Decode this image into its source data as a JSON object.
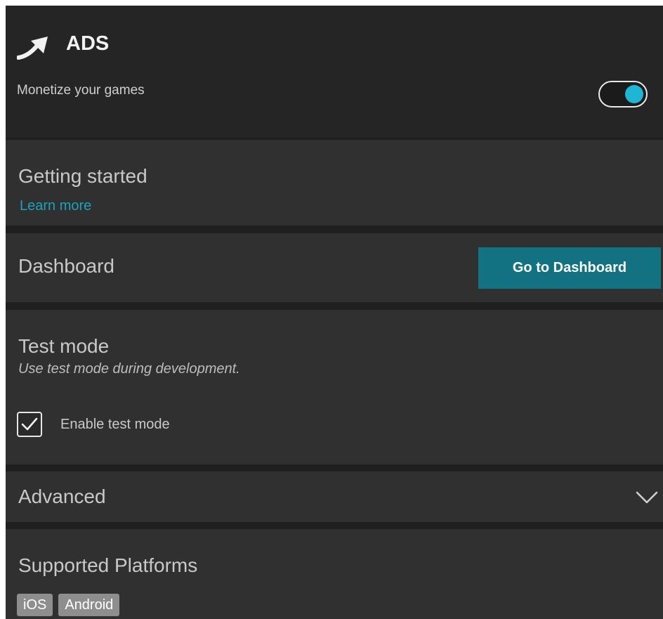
{
  "header": {
    "title": "ADS",
    "subtitle": "Monetize your games",
    "icon": "upward-curved-arrow-icon",
    "toggle": {
      "on": true,
      "knob_color": "#1fb6d6"
    }
  },
  "getting_started": {
    "title": "Getting started",
    "link": "Learn more"
  },
  "dashboard": {
    "title": "Dashboard",
    "button": "Go to Dashboard",
    "button_color": "#137281"
  },
  "test_mode": {
    "title": "Test mode",
    "note": "Use test mode during development.",
    "checkbox_label": "Enable test mode",
    "checked": true
  },
  "advanced": {
    "title": "Advanced",
    "icon": "chevron-down-icon"
  },
  "platforms": {
    "title": "Supported Platforms",
    "items": [
      "iOS",
      "Android"
    ]
  },
  "colors": {
    "accent": "#1aa3bd",
    "background": "#1f1f1f",
    "section": "#303030"
  }
}
